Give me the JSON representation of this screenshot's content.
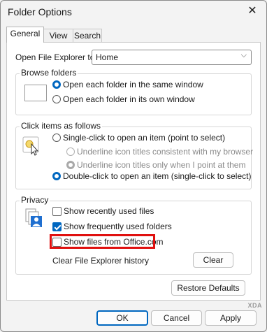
{
  "window": {
    "title": "Folder Options",
    "close_glyph": "✕"
  },
  "tabs": [
    {
      "label": "General",
      "active": true
    },
    {
      "label": "View",
      "active": false
    },
    {
      "label": "Search",
      "active": false
    }
  ],
  "open_explorer": {
    "label": "Open File Explorer to:",
    "value": "Home"
  },
  "browse_folders": {
    "title": "Browse folders",
    "options": [
      {
        "label": "Open each folder in the same window",
        "checked": true
      },
      {
        "label": "Open each folder in its own window",
        "checked": false
      }
    ]
  },
  "click_items": {
    "title": "Click items as follows",
    "options": [
      {
        "label": "Single-click to open an item (point to select)",
        "checked": false
      },
      {
        "label": "Underline icon titles consistent with my browser",
        "checked": false,
        "disabled": true
      },
      {
        "label": "Underline icon titles only when I point at them",
        "checked": true,
        "disabled": true
      },
      {
        "label": "Double-click to open an item (single-click to select)",
        "checked": true
      }
    ]
  },
  "privacy": {
    "title": "Privacy",
    "options": [
      {
        "label": "Show recently used files",
        "checked": false
      },
      {
        "label": "Show frequently used folders",
        "checked": true
      },
      {
        "label": "Show files from Office.com",
        "checked": false
      }
    ],
    "clear_history_label": "Clear File Explorer history",
    "clear_button": "Clear"
  },
  "restore_defaults": "Restore Defaults",
  "footer": {
    "ok": "OK",
    "cancel": "Cancel",
    "apply": "Apply"
  },
  "watermark": "XDA",
  "colors": {
    "accent": "#0067c0",
    "highlight": "#e0100f"
  }
}
